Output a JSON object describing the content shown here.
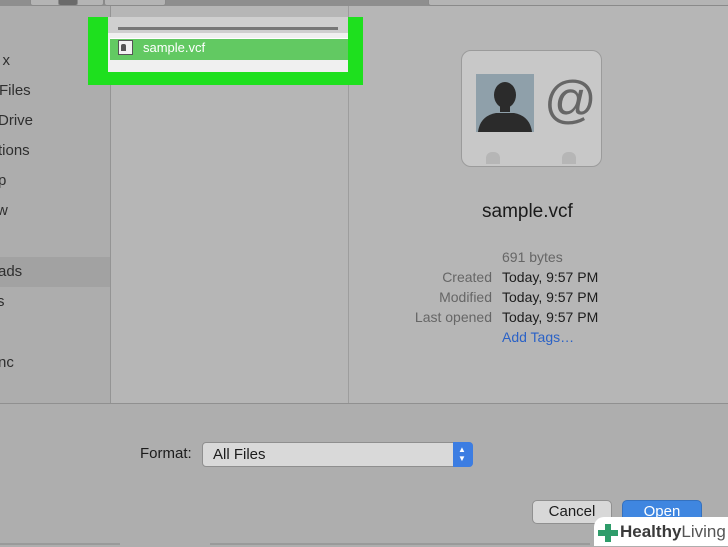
{
  "sidebar": {
    "items": [
      {
        "label": "x"
      },
      {
        "label": "Files"
      },
      {
        "label": "Drive"
      },
      {
        "label": "tions"
      },
      {
        "label": "p"
      },
      {
        "label": "w"
      },
      {
        "label": "ads"
      },
      {
        "label": "s"
      },
      {
        "label": "nc"
      }
    ]
  },
  "file_list": {
    "selected": {
      "name": "sample.vcf",
      "icon": "vcard-file-icon"
    }
  },
  "preview": {
    "file_name": "sample.vcf",
    "size": "691 bytes",
    "created_label": "Created",
    "created": "Today, 9:57 PM",
    "modified_label": "Modified",
    "modified": "Today, 9:57 PM",
    "opened_label": "Last opened",
    "opened": "Today, 9:57 PM",
    "add_tags": "Add Tags…"
  },
  "footer": {
    "format_label": "Format:",
    "format_value": "All Files",
    "cancel": "Cancel",
    "open": "Open"
  },
  "watermark": {
    "bold": "Healthy",
    "thin": "Living"
  },
  "colors": {
    "highlight": "#1ee01e",
    "selection": "#62c962",
    "accent": "#3f86e0",
    "link": "#2b62c6"
  }
}
